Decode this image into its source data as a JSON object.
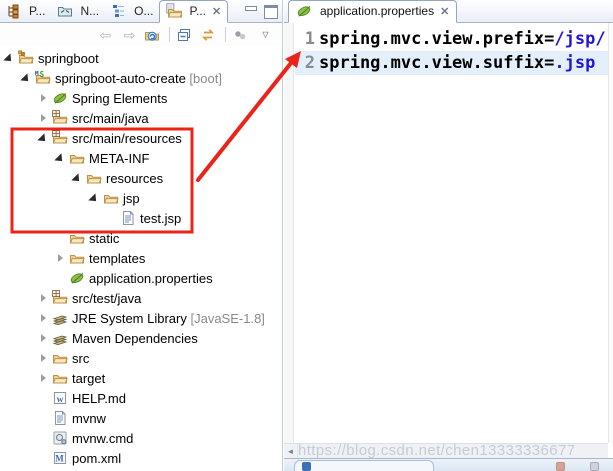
{
  "left_panel": {
    "tabs": [
      {
        "label": "P...",
        "icon": "project-explorer-icon",
        "active": false
      },
      {
        "label": "N...",
        "icon": "navigator-icon",
        "active": false
      },
      {
        "label": "O...",
        "icon": "outline-icon",
        "active": false
      },
      {
        "label": "P...",
        "icon": "package-explorer-icon",
        "active": true,
        "close": "✕"
      }
    ],
    "window_buttons": [
      "minimize-icon",
      "maximize-icon"
    ],
    "toolbar_icons": [
      "back-arrow",
      "forward-arrow",
      "go-into-folder",
      "collapse-all",
      "link-with-editor",
      "focus-view",
      "view-menu"
    ],
    "tree": {
      "items": [
        {
          "label": "springboot",
          "level": 0,
          "caret": "expanded",
          "icon": "workingset-folder"
        },
        {
          "label": "springboot-auto-create",
          "suffix": " [boot]",
          "level": 1,
          "caret": "expanded",
          "icon": "maven-spring-project"
        },
        {
          "label": "Spring Elements",
          "level": 2,
          "caret": "collapsed",
          "icon": "spring-leaf"
        },
        {
          "label": "src/main/java",
          "level": 2,
          "caret": "collapsed",
          "icon": "source-folder"
        },
        {
          "label": "src/main/resources",
          "level": 2,
          "caret": "expanded",
          "icon": "source-folder"
        },
        {
          "label": "META-INF",
          "level": 3,
          "caret": "expanded",
          "icon": "folder"
        },
        {
          "label": "resources",
          "level": 4,
          "caret": "expanded",
          "icon": "folder"
        },
        {
          "label": "jsp",
          "level": 5,
          "caret": "expanded",
          "icon": "folder"
        },
        {
          "label": "test.jsp",
          "level": 6,
          "caret": "none",
          "icon": "text-file"
        },
        {
          "label": "static",
          "level": 3,
          "caret": "none",
          "icon": "folder"
        },
        {
          "label": "templates",
          "level": 3,
          "caret": "collapsed",
          "icon": "folder"
        },
        {
          "label": "application.properties",
          "level": 3,
          "caret": "none",
          "icon": "spring-leaf"
        },
        {
          "label": "src/test/java",
          "level": 2,
          "caret": "collapsed",
          "icon": "source-folder"
        },
        {
          "label": "JRE System Library",
          "suffix": " [JavaSE-1.8]",
          "level": 2,
          "caret": "collapsed",
          "icon": "library"
        },
        {
          "label": "Maven Dependencies",
          "level": 2,
          "caret": "collapsed",
          "icon": "library"
        },
        {
          "label": "src",
          "level": 2,
          "caret": "collapsed",
          "icon": "folder"
        },
        {
          "label": "target",
          "level": 2,
          "caret": "collapsed",
          "icon": "folder"
        },
        {
          "label": "HELP.md",
          "level": 2,
          "caret": "none",
          "icon": "md-file"
        },
        {
          "label": "mvnw",
          "level": 2,
          "caret": "none",
          "icon": "text-file"
        },
        {
          "label": "mvnw.cmd",
          "level": 2,
          "caret": "none",
          "icon": "cmd-file"
        },
        {
          "label": "pom.xml",
          "level": 2,
          "caret": "none",
          "icon": "xml-file"
        }
      ]
    }
  },
  "editor": {
    "tab": {
      "label": "application.properties",
      "icon": "spring-leaf-icon",
      "close": "✕"
    },
    "lines": [
      {
        "number": "1",
        "key": "spring.mvc.view.prefix=",
        "value": "/jsp/",
        "highlighted": false
      },
      {
        "number": "2",
        "key": "spring.mvc.view.suffix=",
        "value": ".jsp",
        "highlighted": true
      }
    ],
    "scrollbar_arrow": "◄"
  },
  "bottom_bar": {
    "icons": [
      "blue-view-icon",
      "red-view-icon",
      "gray-view-icon"
    ]
  },
  "watermark": "https://blog.csdn.net/chen13333336677",
  "colors": {
    "annotation_red": "#ec2318",
    "value_blue": "#2016d2",
    "line_highlight": "#e3effb"
  }
}
